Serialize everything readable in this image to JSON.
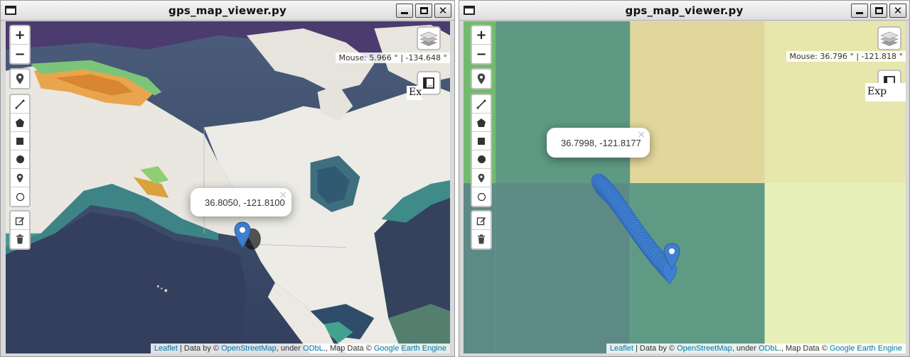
{
  "windows": [
    {
      "title": "gps_map_viewer.py",
      "mouse_readout": "Mouse: 5.966 ° | -134.648 °",
      "popup_text": "36.8050, -121.8100",
      "export_label": "Exp"
    },
    {
      "title": "gps_map_viewer.py",
      "mouse_readout": "Mouse: 36.796 ° | -121.818 °",
      "popup_text": "36.7998, -121.8177",
      "export_label": "Exp"
    }
  ],
  "window_buttons": {
    "minimize": "_",
    "maximize": "□",
    "close": "✕"
  },
  "zoom": {
    "in": "+",
    "out": "−"
  },
  "popup_close": "×",
  "attribution": {
    "leaflet": "Leaflet",
    "sep1": " | Data by © ",
    "osm": "OpenStreetMap",
    "under": ", under ",
    "odbl": "ODbL",
    "map_data": "., Map Data © ",
    "gee": "Google Earth Engine"
  },
  "icons": {
    "app": "window-icon",
    "locate": "location-pin-icon",
    "draw_tools": [
      "polyline-icon",
      "polygon-icon",
      "rectangle-icon",
      "circle-icon",
      "marker-icon",
      "circle-marker-icon"
    ],
    "edit": "edit-icon",
    "delete": "trash-icon",
    "layers": "layers-icon",
    "fullscreen": "fullscreen-icon",
    "marker": "map-marker-icon"
  },
  "colors": {
    "marker_blue": "#3f7fd0",
    "link": "#0078a8",
    "ocean_deep": "#3b4e6b",
    "land_light": "#eceae4"
  }
}
